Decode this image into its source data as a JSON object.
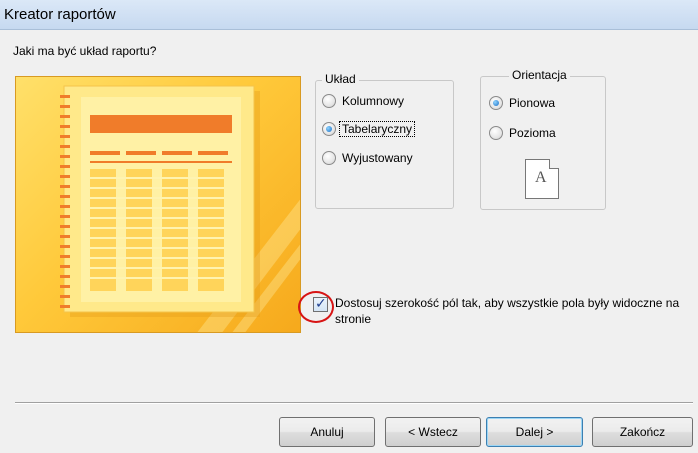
{
  "window": {
    "title": "Kreator raportów"
  },
  "question": "Jaki ma być układ raportu?",
  "layout_group": {
    "legend": "Układ",
    "options": [
      {
        "label": "Kolumnowy",
        "selected": false
      },
      {
        "label": "Tabelaryczny",
        "selected": true
      },
      {
        "label": "Wyjustowany",
        "selected": false
      }
    ]
  },
  "orientation_group": {
    "legend": "Orientacja",
    "options": [
      {
        "label": "Pionowa",
        "selected": true
      },
      {
        "label": "Pozioma",
        "selected": false
      }
    ],
    "page_glyph": "A"
  },
  "fit_checkbox": {
    "checked": true,
    "label": "Dostosuj szerokość pól tak, aby wszystkie pola były widoczne na stronie"
  },
  "buttons": {
    "cancel": "Anuluj",
    "back": "< Wstecz",
    "next": "Dalej >",
    "finish": "Zakończ"
  },
  "colors": {
    "preview_accent": "#f07c2a",
    "highlight_ring": "#d71414"
  }
}
